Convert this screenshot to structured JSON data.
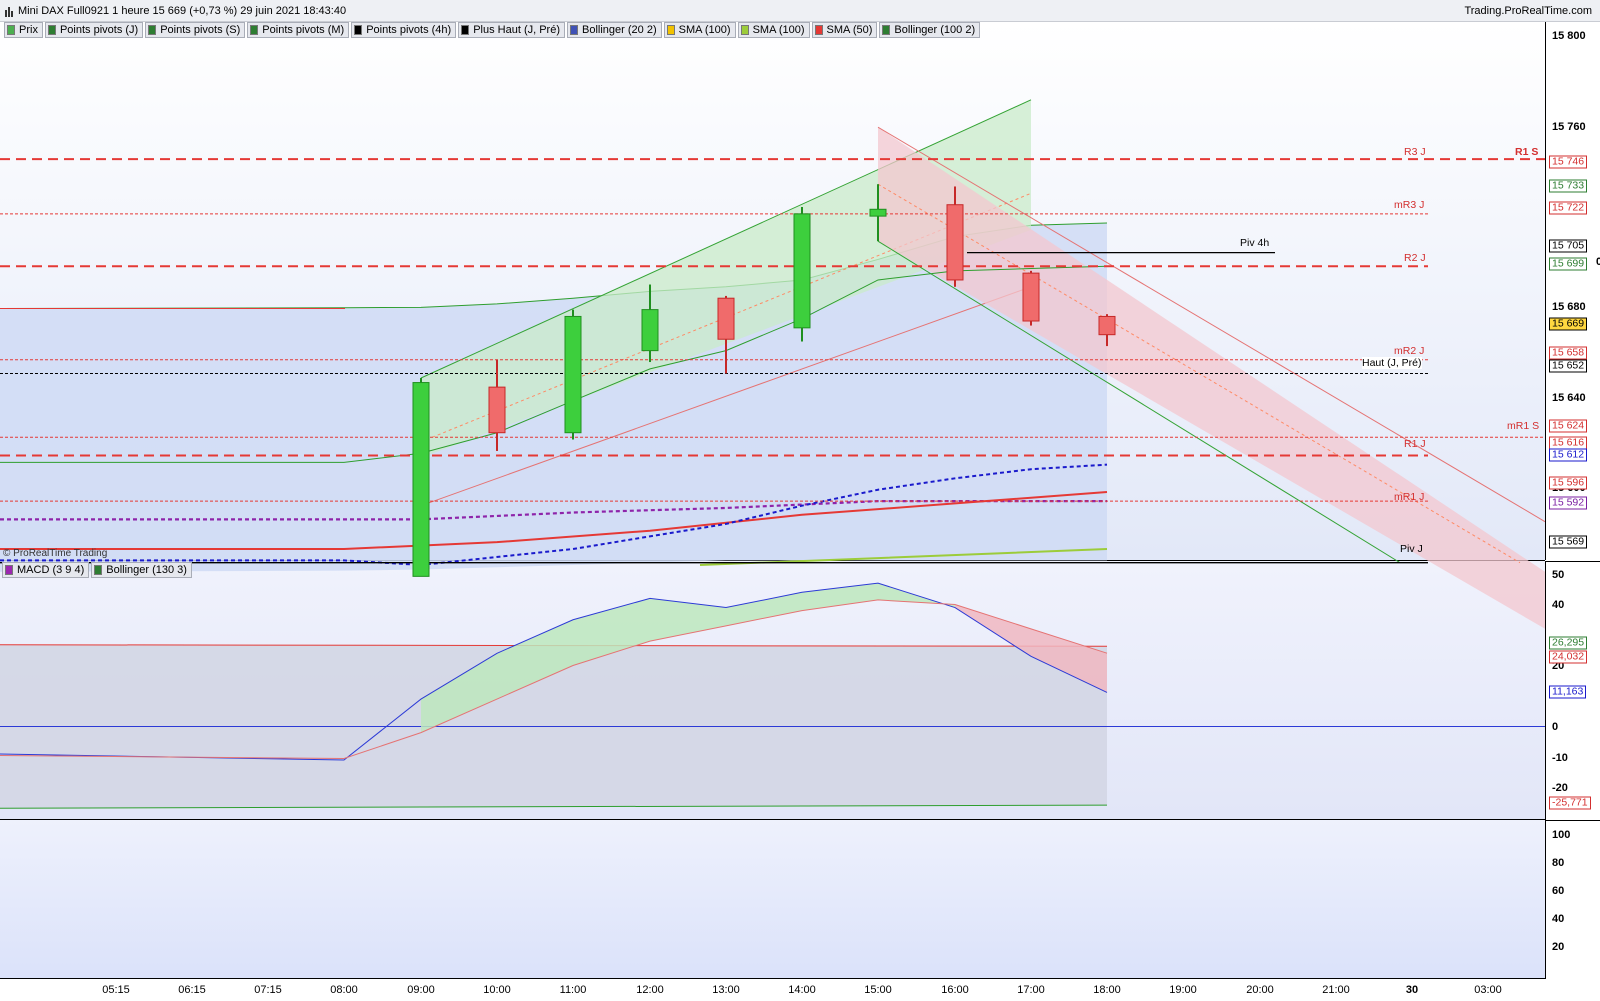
{
  "window": {
    "title": "Mini DAX Full0921 1 heure 15 669 (+0,73 %) 29 juin 2021 18:43:40",
    "brand": "Trading.ProRealTime.com"
  },
  "price_legend": [
    {
      "label": "Prix",
      "color": "#4caf50"
    },
    {
      "label": "Points pivots (J)",
      "color": "#2e7d32"
    },
    {
      "label": "Points pivots (S)",
      "color": "#2e7d32"
    },
    {
      "label": "Points pivots (M)",
      "color": "#2e7d32"
    },
    {
      "label": "Points pivots (4h)",
      "color": "#000000"
    },
    {
      "label": "Plus Haut (J, Pré)",
      "color": "#000000"
    },
    {
      "label": "Bollinger (20 2)",
      "color": "#3f51b5"
    },
    {
      "label": "SMA (100)",
      "color": "#f2c200"
    },
    {
      "label": "SMA (100)",
      "color": "#9ccc3a"
    },
    {
      "label": "SMA (50)",
      "color": "#e53935"
    },
    {
      "label": "Bollinger (100 2)",
      "color": "#2e7d32"
    }
  ],
  "macd_legend": [
    {
      "label": "MACD (3 9 4)",
      "color": "#9c27b0"
    },
    {
      "label": "Bollinger (130 3)",
      "color": "#2e7d32"
    }
  ],
  "watermark": "© ProRealTime Trading",
  "price_axis": {
    "ticks": [
      "15 800",
      "15 760",
      "15 680",
      "15 640"
    ],
    "partial_ticks": [
      "0",
      "15 600"
    ]
  },
  "macd_axis": {
    "ticks": [
      "50",
      "40",
      "20",
      "0",
      "-10",
      "-20"
    ]
  },
  "bottom_axis": {
    "ticks": [
      "100",
      "80",
      "60",
      "40",
      "20"
    ]
  },
  "time_axis": {
    "ticks": [
      "05:15",
      "06:15",
      "07:15",
      "08:00",
      "09:00",
      "10:00",
      "11:00",
      "12:00",
      "13:00",
      "14:00",
      "15:00",
      "16:00",
      "17:00",
      "18:00",
      "19:00",
      "20:00",
      "21:00",
      "30",
      "03:00"
    ]
  },
  "pivot_labels": {
    "r3": "R3 J",
    "mr3": "mR3 J",
    "r2": "R2 J",
    "mr2": "mR2 J",
    "r1": "R1 J",
    "mr1s": "mR1 S",
    "mr1": "mR1 J",
    "pivj": "Piv J",
    "piv4h": "Piv 4h",
    "haut": "Haut (J, Pré)",
    "r1s": "R1 S"
  },
  "price_values": [
    {
      "text": "15 746",
      "color": "#d32f2f"
    },
    {
      "text": "15 733",
      "color": "#2e7d32"
    },
    {
      "text": "15 722",
      "color": "#d32f2f"
    },
    {
      "text": "15 705",
      "color": "#000000"
    },
    {
      "text": "15 699",
      "color": "#2e7d32"
    },
    {
      "text": "15 669",
      "color": "#000000"
    },
    {
      "text": "15 658",
      "color": "#d32f2f"
    },
    {
      "text": "15 652",
      "color": "#000000"
    },
    {
      "text": "15 624",
      "color": "#d32f2f"
    },
    {
      "text": "15 616",
      "color": "#d32f2f"
    },
    {
      "text": "15 612",
      "color": "#1a1acc"
    },
    {
      "text": "15 596",
      "color": "#d32f2f"
    },
    {
      "text": "15 592",
      "color": "#7b1fa2"
    },
    {
      "text": "15 569",
      "color": "#000000"
    }
  ],
  "macd_values": [
    {
      "text": "26,295",
      "color": "#2e7d32"
    },
    {
      "text": "24,032",
      "color": "#d32f2f"
    },
    {
      "text": "11,163",
      "color": "#1a1acc"
    },
    {
      "text": "-25,771",
      "color": "#d32f2f"
    }
  ],
  "chart_data": {
    "type": "candlestick",
    "title": "Mini DAX Full0921 1 heure",
    "candles": [
      {
        "time": "09:00",
        "open": 15563,
        "high": 15650,
        "low": 15563,
        "close": 15648
      },
      {
        "time": "10:00",
        "open": 15646,
        "high": 15658,
        "low": 15618,
        "close": 15626
      },
      {
        "time": "11:00",
        "open": 15626,
        "high": 15680,
        "low": 15623,
        "close": 15677
      },
      {
        "time": "12:00",
        "open": 15662,
        "high": 15691,
        "low": 15657,
        "close": 15680
      },
      {
        "time": "13:00",
        "open": 15685,
        "high": 15686,
        "low": 15652,
        "close": 15667
      },
      {
        "time": "14:00",
        "open": 15672,
        "high": 15725,
        "low": 15666,
        "close": 15722
      },
      {
        "time": "15:00",
        "open": 15721,
        "high": 15735,
        "low": 15710,
        "close": 15724
      },
      {
        "time": "16:00",
        "open": 15726,
        "high": 15734,
        "low": 15690,
        "close": 15693
      },
      {
        "time": "17:00",
        "open": 15696,
        "high": 15697,
        "low": 15673,
        "close": 15675
      },
      {
        "time": "18:00",
        "open": 15677,
        "high": 15678,
        "low": 15664,
        "close": 15669
      }
    ],
    "pivots": [
      {
        "name": "R3 J",
        "value": 15746,
        "style": "dashed-heavy"
      },
      {
        "name": "mR3 J",
        "value": 15722,
        "style": "dotted"
      },
      {
        "name": "R2 J",
        "value": 15699,
        "style": "dashed-heavy"
      },
      {
        "name": "mR2 J",
        "value": 15658,
        "style": "dotted"
      },
      {
        "name": "mR1 S",
        "value": 15624,
        "style": "dotted"
      },
      {
        "name": "R1 J",
        "value": 15616,
        "style": "dashed-heavy"
      },
      {
        "name": "mR1 J",
        "value": 15596,
        "style": "dotted"
      },
      {
        "name": "Piv J",
        "value": 15569,
        "style": "solid-black"
      },
      {
        "name": "Haut (J, Pré)",
        "value": 15652,
        "style": "dotted-black"
      },
      {
        "name": "Piv 4h",
        "value": 15705,
        "style": "solid-black"
      }
    ],
    "y_range": [
      15568,
      15808
    ],
    "macd": {
      "x": [
        "05:15",
        "08:00",
        "09:00",
        "10:00",
        "11:00",
        "12:00",
        "13:00",
        "14:00",
        "15:00",
        "16:00",
        "17:00",
        "18:00"
      ],
      "macd_line": [
        -9,
        -11,
        9,
        24,
        35,
        42,
        39,
        44,
        47,
        39,
        23,
        11.163
      ],
      "signal_line": [
        -9.5,
        -10.5,
        -2,
        9,
        20,
        28,
        33,
        38,
        41.5,
        40,
        32,
        24.032
      ],
      "bollinger_upper": 26.295,
      "bollinger_lower": -25.771,
      "y_range": [
        -28,
        55
      ]
    }
  }
}
